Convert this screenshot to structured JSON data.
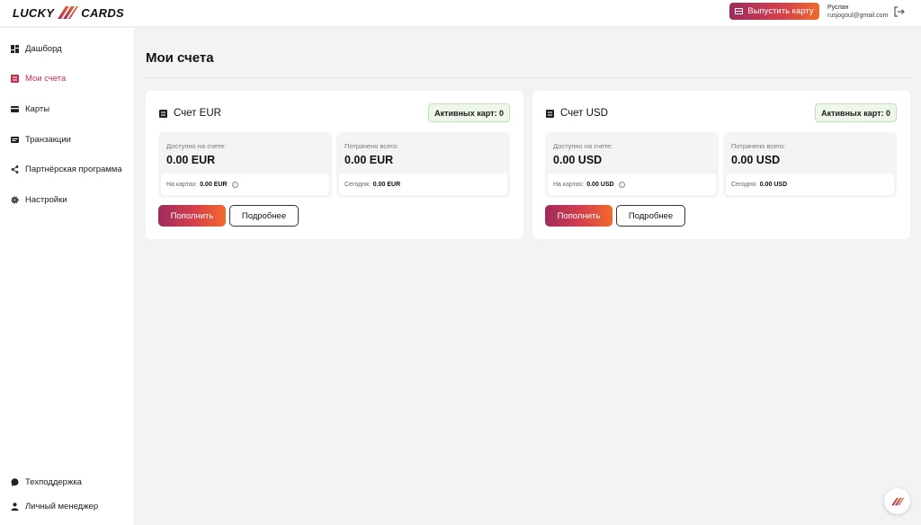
{
  "header": {
    "logo_left": "LUCKY",
    "logo_right": "CARDS",
    "issue_card_label": "Выпустить карту",
    "user_name": "Руслан",
    "user_email": "rusjogoul@gmail.com"
  },
  "sidebar": {
    "items": [
      {
        "label": "Дашборд",
        "icon": "dashboard-icon"
      },
      {
        "label": "Мои счета",
        "icon": "accounts-icon",
        "active": true
      },
      {
        "label": "Карты",
        "icon": "card-icon"
      },
      {
        "label": "Транзакции",
        "icon": "transactions-icon"
      },
      {
        "label": "Партнёрская программа",
        "icon": "share-icon"
      },
      {
        "label": "Настройки",
        "icon": "gear-icon"
      }
    ],
    "bottom": [
      {
        "label": "Техподдержка",
        "icon": "chat-icon"
      },
      {
        "label": "Личный менеджер",
        "icon": "person-icon"
      }
    ]
  },
  "main": {
    "title": "Мои счета",
    "accounts": [
      {
        "title": "Счет EUR",
        "active_cards": "Активных карт: 0",
        "available_label": "Доступно на счете:",
        "available_value": "0.00 EUR",
        "on_cards_label": "На картах:",
        "on_cards_value": "0.00 EUR",
        "spent_label": "Потрачено всего:",
        "spent_value": "0.00 EUR",
        "today_label": "Сегодня:",
        "today_value": "0.00 EUR",
        "topup_label": "Пополнить",
        "details_label": "Подробнее"
      },
      {
        "title": "Счет USD",
        "active_cards": "Активных карт: 0",
        "available_label": "Доступно на счете:",
        "available_value": "0.00 USD",
        "on_cards_label": "На картах:",
        "on_cards_value": "0.00 USD",
        "spent_label": "Потрачено всего:",
        "spent_value": "0.00 USD",
        "today_label": "Сегодня:",
        "today_value": "0.00 USD",
        "topup_label": "Пополнить",
        "details_label": "Подробнее"
      }
    ]
  },
  "colors": {
    "accent": "#c0304f",
    "gradient_start": "#9e2b5e",
    "gradient_end": "#f06a2b",
    "badge_border": "#bfe3b6"
  }
}
